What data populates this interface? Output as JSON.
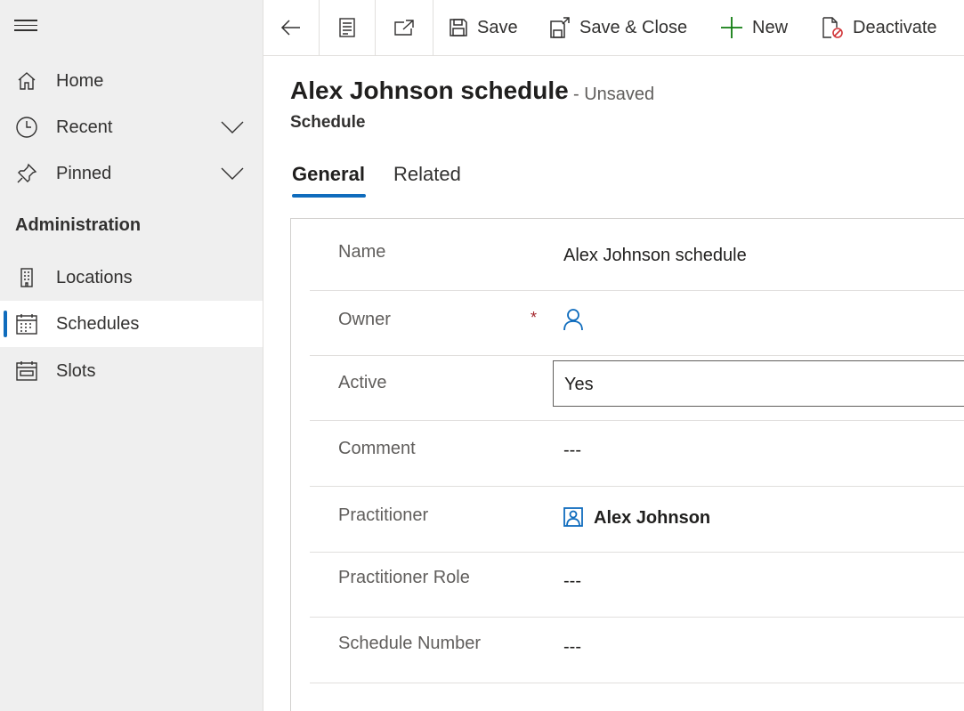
{
  "nav": {
    "items": [
      {
        "label": "Home",
        "icon": "home-icon"
      },
      {
        "label": "Recent",
        "icon": "clock-icon"
      },
      {
        "label": "Pinned",
        "icon": "pin-icon"
      }
    ],
    "section_title": "Administration",
    "section_items": [
      {
        "label": "Locations",
        "icon": "building-icon"
      },
      {
        "label": "Schedules",
        "icon": "calendar-icon",
        "selected": true
      },
      {
        "label": "Slots",
        "icon": "slots-icon"
      }
    ]
  },
  "commandbar": {
    "save": "Save",
    "save_close": "Save & Close",
    "new": "New",
    "deactivate": "Deactivate"
  },
  "record": {
    "title": "Alex Johnson schedule",
    "status": "- Unsaved",
    "entity": "Schedule"
  },
  "tabs": [
    {
      "label": "General",
      "active": true
    },
    {
      "label": "Related",
      "active": false
    }
  ],
  "form": {
    "name_label": "Name",
    "name_value": "Alex Johnson schedule",
    "owner_label": "Owner",
    "owner_required": "*",
    "active_label": "Active",
    "active_value": "Yes",
    "comment_label": "Comment",
    "comment_value": "---",
    "practitioner_label": "Practitioner",
    "practitioner_value": "Alex Johnson",
    "practitioner_role_label": "Practitioner Role",
    "practitioner_role_value": "---",
    "schedule_number_label": "Schedule Number",
    "schedule_number_value": "---"
  },
  "colors": {
    "accent": "#0f6cbd",
    "required": "#a4262c",
    "new_icon": "#107c10",
    "deactivate_icon": "#d13438"
  }
}
